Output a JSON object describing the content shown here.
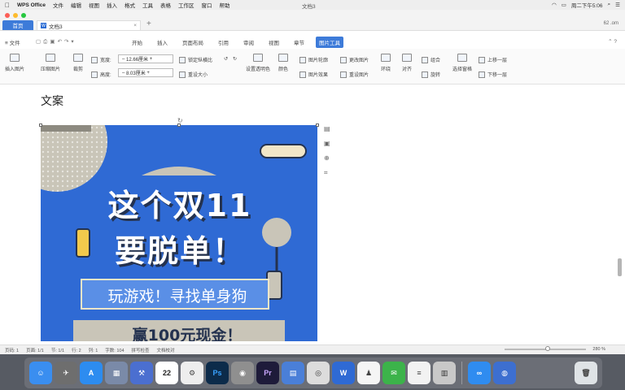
{
  "menubar": {
    "app": "WPS Office",
    "items": [
      "文件",
      "编辑",
      "视图",
      "插入",
      "格式",
      "工具",
      "表格",
      "工作区",
      "窗口",
      "帮助"
    ],
    "window_title": "文档3",
    "clock": "周二下午5:06"
  },
  "tabs": {
    "home": "首页",
    "doc": "文档3",
    "cloud": "62 .om"
  },
  "ribbon": {
    "file_menu": "≡ 文件",
    "tabs": [
      "开始",
      "插入",
      "页面布局",
      "引用",
      "审阅",
      "视图",
      "章节",
      "图片工具"
    ],
    "active_tab": "图片工具"
  },
  "toolbar": {
    "insert_picture": "插入图片",
    "compress_picture": "压缩图片",
    "crop": "裁剪",
    "width_label": "宽度:",
    "width_value": "12.66厘米",
    "height_label": "高度:",
    "height_value": "8.03厘米",
    "lock_ratio": "锁定纵横比",
    "reset_size": "重设大小",
    "set_transparent": "设置透明色",
    "color": "颜色",
    "outline": "图片轮廓",
    "change_picture": "更改图片",
    "effect": "图片效果",
    "reset_picture": "重设图片",
    "wrap": "环绕",
    "align": "对齐",
    "group": "组合",
    "rotate": "旋转",
    "select_pane": "选择窗格",
    "bring_forward": "上移一层",
    "send_backward": "下移一层"
  },
  "document": {
    "heading": "文案",
    "poster": {
      "line1": "这个双11",
      "line2": "要脱单！",
      "banner": "玩游戏！寻找单身狗",
      "prize": "赢100元现金！",
      "colors": {
        "bg": "#2f6ad4",
        "accent": "#f2c94c",
        "dark": "#24324f"
      }
    }
  },
  "status": {
    "page": "页码: 1",
    "pages": "页面: 1/1",
    "section": "节: 1/1",
    "row": "行: 2",
    "col": "列: 1",
    "words": "字数: 104",
    "spell": "拼写检查",
    "doc_check": "文档校对",
    "zoom": "280 %"
  },
  "dock": {
    "calendar_day": "22"
  }
}
